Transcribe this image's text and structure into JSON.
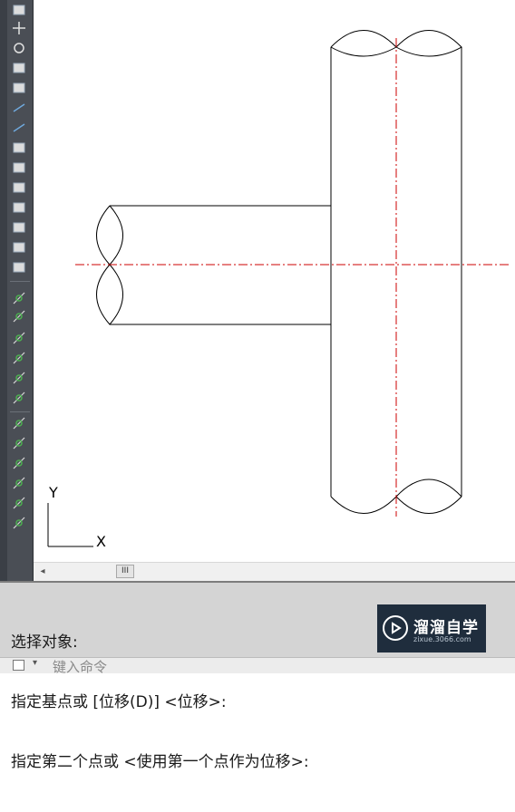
{
  "toolbar": {
    "tools": [
      {
        "name": "select-icon"
      },
      {
        "name": "move-icon"
      },
      {
        "name": "rotate-icon"
      },
      {
        "name": "scale-icon"
      },
      {
        "name": "stretch-icon"
      },
      {
        "name": "trim-icon"
      },
      {
        "name": "extend-icon"
      },
      {
        "name": "break-icon"
      },
      {
        "name": "join-icon"
      },
      {
        "name": "break-at-point-icon"
      },
      {
        "name": "chamfer-icon"
      },
      {
        "name": "fillet-icon"
      },
      {
        "name": "blend-icon"
      },
      {
        "name": "explode-icon"
      },
      {
        "name": "snap-endpoint-icon"
      },
      {
        "name": "snap-midpoint-icon"
      },
      {
        "name": "snap-intersection-icon"
      },
      {
        "name": "snap-apparent-icon"
      },
      {
        "name": "snap-extension-icon"
      },
      {
        "name": "snap-center-icon"
      },
      {
        "name": "snap-quadrant-icon"
      },
      {
        "name": "snap-tangent-icon"
      },
      {
        "name": "snap-perpendicular-icon"
      },
      {
        "name": "snap-parallel-icon"
      },
      {
        "name": "snap-node-icon"
      },
      {
        "name": "snap-insert-icon"
      }
    ]
  },
  "ucs": {
    "y_label": "Y",
    "x_label": "X"
  },
  "colors": {
    "geometry": "#000000",
    "centerline": "#cc0000",
    "toolbar": "#4a4e55",
    "command_bg": "#d4d4d4"
  },
  "command": {
    "lines": [
      "选择对象:",
      "指定基点或 [位移(D)] <位移>:",
      "指定第二个点或 <使用第一个点作为位移>:"
    ],
    "placeholder": "键入命令"
  },
  "scrollbar": {
    "thumb_label": "III"
  },
  "watermark": {
    "title": "溜溜自学",
    "url": "zixue.3066.com"
  }
}
